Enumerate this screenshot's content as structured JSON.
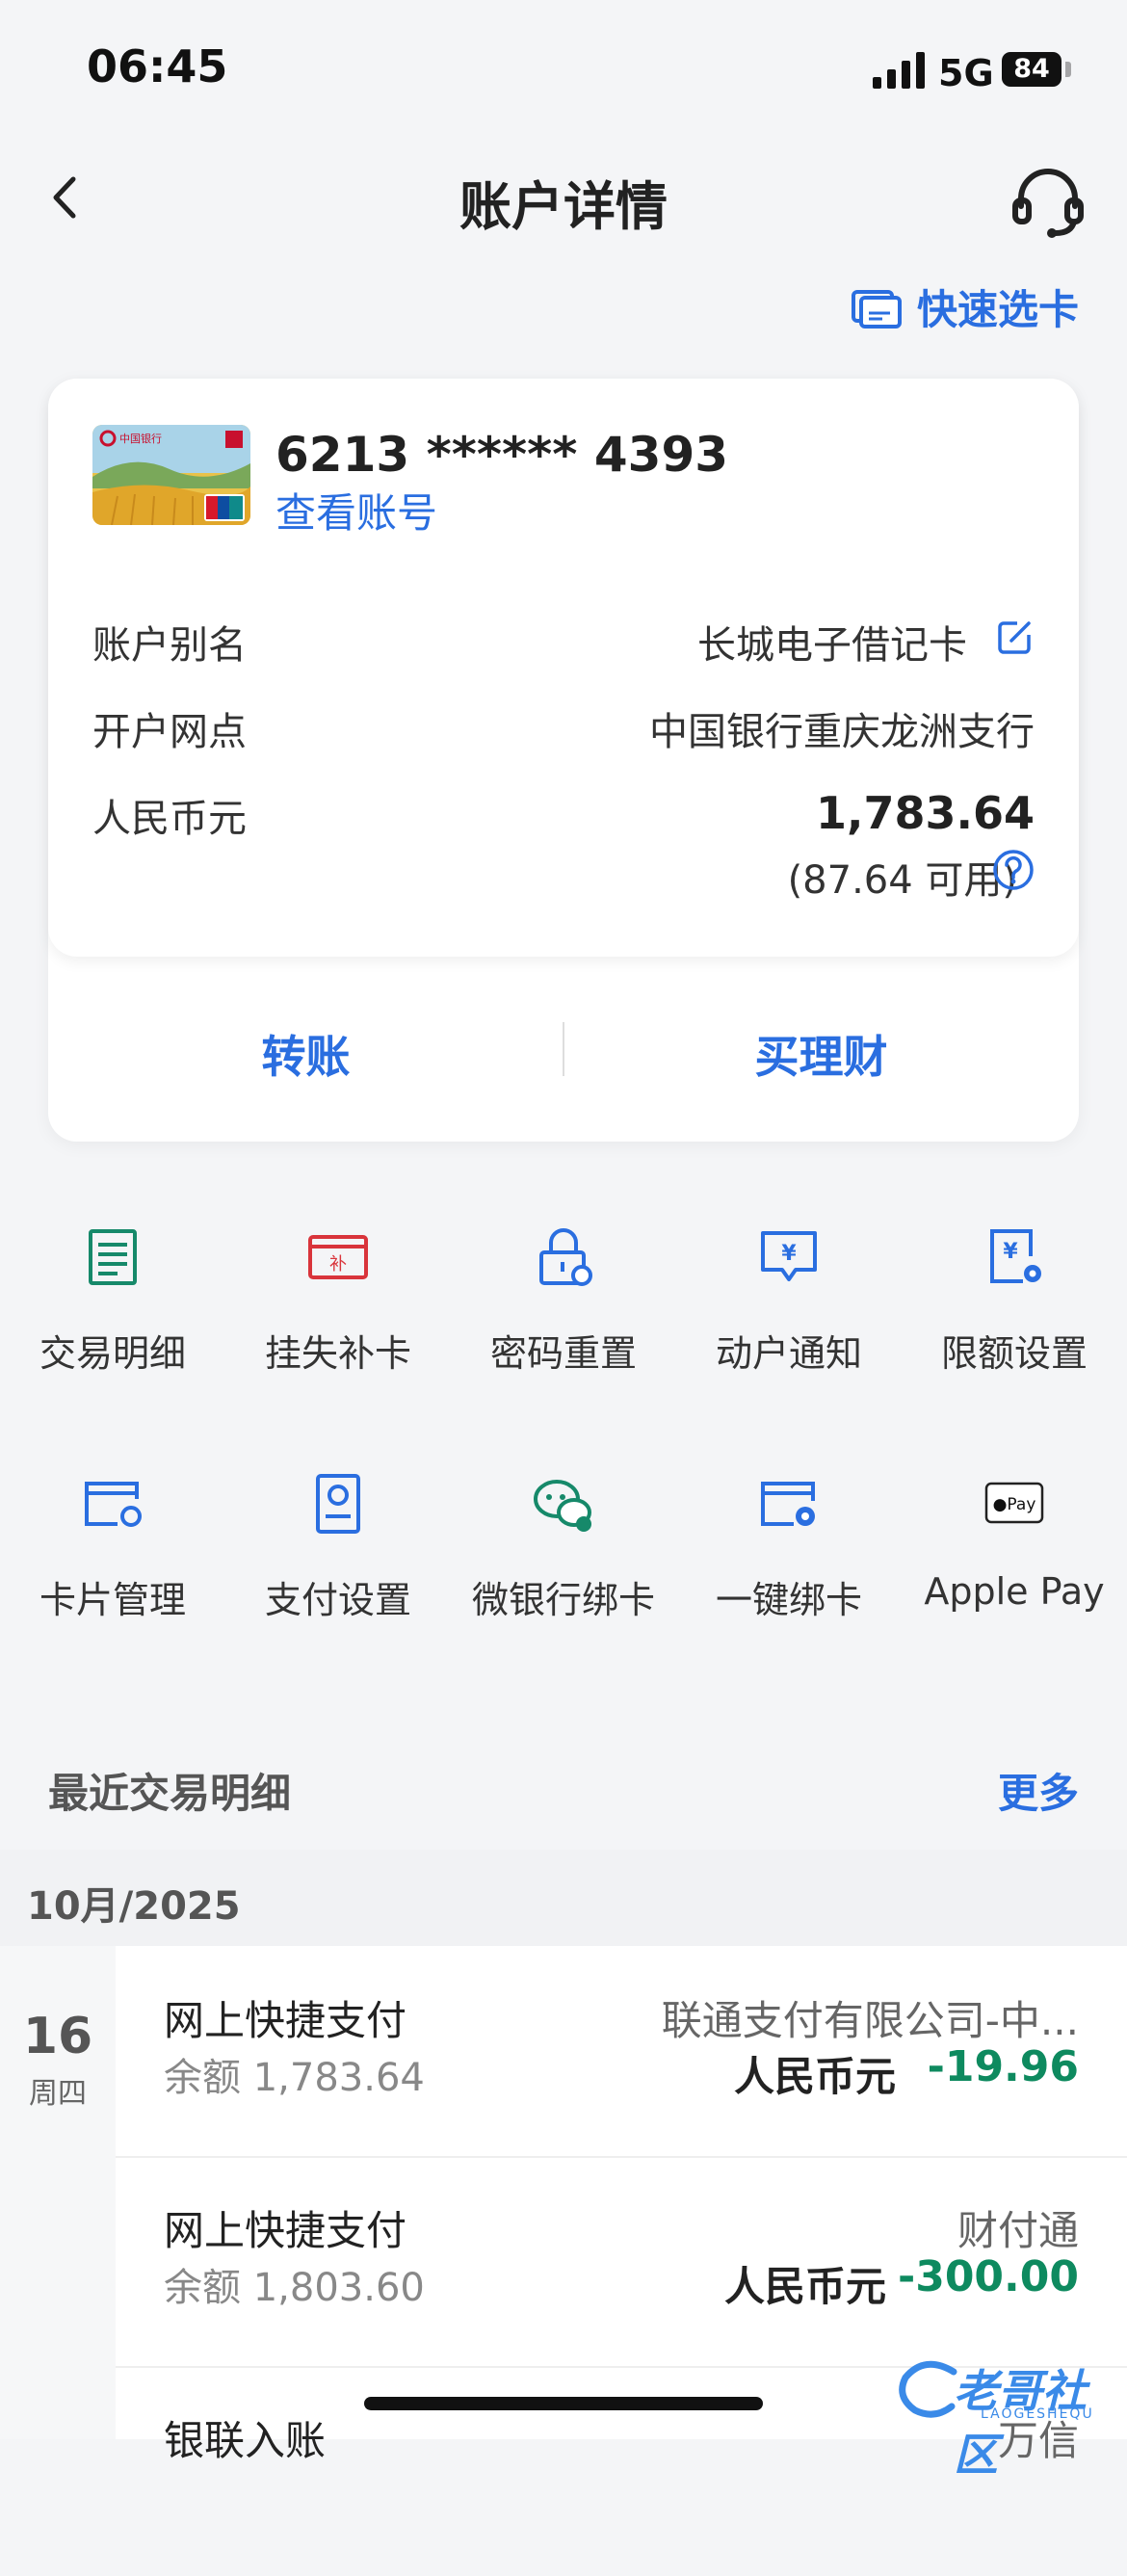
{
  "status": {
    "time": "06:45",
    "network": "5G",
    "battery": "84"
  },
  "nav": {
    "title": "账户详情"
  },
  "quick_select": {
    "label": "快速选卡"
  },
  "card": {
    "number": "6213 ****** 4393",
    "view_account": "查看账号",
    "image_text": "中国银行",
    "unionpay_text": "UnionPay"
  },
  "details": {
    "alias_label": "账户别名",
    "alias_value": "长城电子借记卡",
    "branch_label": "开户网点",
    "branch_value": "中国银行重庆龙洲支行",
    "currency_label": "人民币元",
    "balance": "1,783.64",
    "available": "(87.64 可用)"
  },
  "actions": {
    "transfer": "转账",
    "wealth": "买理财"
  },
  "functions": [
    {
      "label": "交易明细",
      "icon": "document-icon"
    },
    {
      "label": "挂失补卡",
      "icon": "report-loss-icon"
    },
    {
      "label": "密码重置",
      "icon": "lock-reset-icon"
    },
    {
      "label": "动户通知",
      "icon": "notification-icon"
    },
    {
      "label": "限额设置",
      "icon": "limit-setting-icon"
    },
    {
      "label": "卡片管理",
      "icon": "card-manage-icon"
    },
    {
      "label": "支付设置",
      "icon": "payment-setting-icon"
    },
    {
      "label": "微银行绑卡",
      "icon": "wechat-bind-icon"
    },
    {
      "label": "一键绑卡",
      "icon": "one-click-bind-icon"
    },
    {
      "label": "Apple Pay",
      "icon": "apple-pay-icon"
    }
  ],
  "recent": {
    "title": "最近交易明细",
    "more": "更多",
    "month": "10月/2025"
  },
  "date_group": {
    "day": "16",
    "weekday": "周四"
  },
  "transactions": [
    {
      "title": "网上快捷支付",
      "balance": "余额 1,783.64",
      "merchant": "联通支付有限公司-中...",
      "currency": "人民币元",
      "amount": "-19.96"
    },
    {
      "title": "网上快捷支付",
      "balance": "余额 1,803.60",
      "merchant": "财付通",
      "currency": "人民币元",
      "amount": "-300.00"
    },
    {
      "title": "银联入账",
      "balance": "",
      "merchant": "万信",
      "currency": "",
      "amount": ""
    }
  ],
  "watermark": {
    "text": "老哥社区",
    "sub": "LAOGESHEQU"
  },
  "colors": {
    "accent": "#2a6ee0",
    "debit_green": "#0e8a5f",
    "icon_red": "#d9343b",
    "icon_green": "#16896a"
  }
}
